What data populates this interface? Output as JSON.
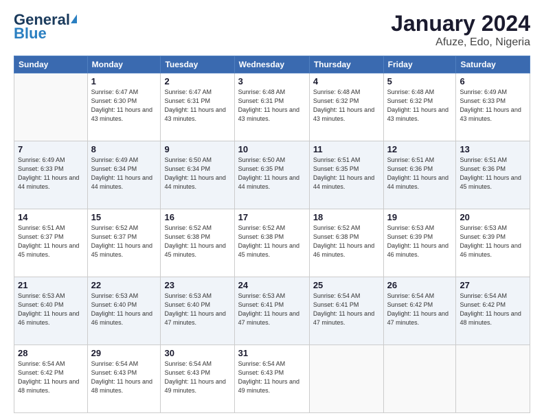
{
  "header": {
    "logo_general": "General",
    "logo_blue": "Blue",
    "title": "January 2024",
    "subtitle": "Afuze, Edo, Nigeria"
  },
  "days_of_week": [
    "Sunday",
    "Monday",
    "Tuesday",
    "Wednesday",
    "Thursday",
    "Friday",
    "Saturday"
  ],
  "weeks": [
    [
      null,
      {
        "day": 1,
        "sunrise": "6:47 AM",
        "sunset": "6:30 PM",
        "daylight": "11 hours and 43 minutes."
      },
      {
        "day": 2,
        "sunrise": "6:47 AM",
        "sunset": "6:31 PM",
        "daylight": "11 hours and 43 minutes."
      },
      {
        "day": 3,
        "sunrise": "6:48 AM",
        "sunset": "6:31 PM",
        "daylight": "11 hours and 43 minutes."
      },
      {
        "day": 4,
        "sunrise": "6:48 AM",
        "sunset": "6:32 PM",
        "daylight": "11 hours and 43 minutes."
      },
      {
        "day": 5,
        "sunrise": "6:48 AM",
        "sunset": "6:32 PM",
        "daylight": "11 hours and 43 minutes."
      },
      {
        "day": 6,
        "sunrise": "6:49 AM",
        "sunset": "6:33 PM",
        "daylight": "11 hours and 43 minutes."
      }
    ],
    [
      {
        "day": 7,
        "sunrise": "6:49 AM",
        "sunset": "6:33 PM",
        "daylight": "11 hours and 44 minutes."
      },
      {
        "day": 8,
        "sunrise": "6:49 AM",
        "sunset": "6:34 PM",
        "daylight": "11 hours and 44 minutes."
      },
      {
        "day": 9,
        "sunrise": "6:50 AM",
        "sunset": "6:34 PM",
        "daylight": "11 hours and 44 minutes."
      },
      {
        "day": 10,
        "sunrise": "6:50 AM",
        "sunset": "6:35 PM",
        "daylight": "11 hours and 44 minutes."
      },
      {
        "day": 11,
        "sunrise": "6:51 AM",
        "sunset": "6:35 PM",
        "daylight": "11 hours and 44 minutes."
      },
      {
        "day": 12,
        "sunrise": "6:51 AM",
        "sunset": "6:36 PM",
        "daylight": "11 hours and 44 minutes."
      },
      {
        "day": 13,
        "sunrise": "6:51 AM",
        "sunset": "6:36 PM",
        "daylight": "11 hours and 45 minutes."
      }
    ],
    [
      {
        "day": 14,
        "sunrise": "6:51 AM",
        "sunset": "6:37 PM",
        "daylight": "11 hours and 45 minutes."
      },
      {
        "day": 15,
        "sunrise": "6:52 AM",
        "sunset": "6:37 PM",
        "daylight": "11 hours and 45 minutes."
      },
      {
        "day": 16,
        "sunrise": "6:52 AM",
        "sunset": "6:38 PM",
        "daylight": "11 hours and 45 minutes."
      },
      {
        "day": 17,
        "sunrise": "6:52 AM",
        "sunset": "6:38 PM",
        "daylight": "11 hours and 45 minutes."
      },
      {
        "day": 18,
        "sunrise": "6:52 AM",
        "sunset": "6:38 PM",
        "daylight": "11 hours and 46 minutes."
      },
      {
        "day": 19,
        "sunrise": "6:53 AM",
        "sunset": "6:39 PM",
        "daylight": "11 hours and 46 minutes."
      },
      {
        "day": 20,
        "sunrise": "6:53 AM",
        "sunset": "6:39 PM",
        "daylight": "11 hours and 46 minutes."
      }
    ],
    [
      {
        "day": 21,
        "sunrise": "6:53 AM",
        "sunset": "6:40 PM",
        "daylight": "11 hours and 46 minutes."
      },
      {
        "day": 22,
        "sunrise": "6:53 AM",
        "sunset": "6:40 PM",
        "daylight": "11 hours and 46 minutes."
      },
      {
        "day": 23,
        "sunrise": "6:53 AM",
        "sunset": "6:40 PM",
        "daylight": "11 hours and 47 minutes."
      },
      {
        "day": 24,
        "sunrise": "6:53 AM",
        "sunset": "6:41 PM",
        "daylight": "11 hours and 47 minutes."
      },
      {
        "day": 25,
        "sunrise": "6:54 AM",
        "sunset": "6:41 PM",
        "daylight": "11 hours and 47 minutes."
      },
      {
        "day": 26,
        "sunrise": "6:54 AM",
        "sunset": "6:42 PM",
        "daylight": "11 hours and 47 minutes."
      },
      {
        "day": 27,
        "sunrise": "6:54 AM",
        "sunset": "6:42 PM",
        "daylight": "11 hours and 48 minutes."
      }
    ],
    [
      {
        "day": 28,
        "sunrise": "6:54 AM",
        "sunset": "6:42 PM",
        "daylight": "11 hours and 48 minutes."
      },
      {
        "day": 29,
        "sunrise": "6:54 AM",
        "sunset": "6:43 PM",
        "daylight": "11 hours and 48 minutes."
      },
      {
        "day": 30,
        "sunrise": "6:54 AM",
        "sunset": "6:43 PM",
        "daylight": "11 hours and 49 minutes."
      },
      {
        "day": 31,
        "sunrise": "6:54 AM",
        "sunset": "6:43 PM",
        "daylight": "11 hours and 49 minutes."
      },
      null,
      null,
      null
    ]
  ]
}
